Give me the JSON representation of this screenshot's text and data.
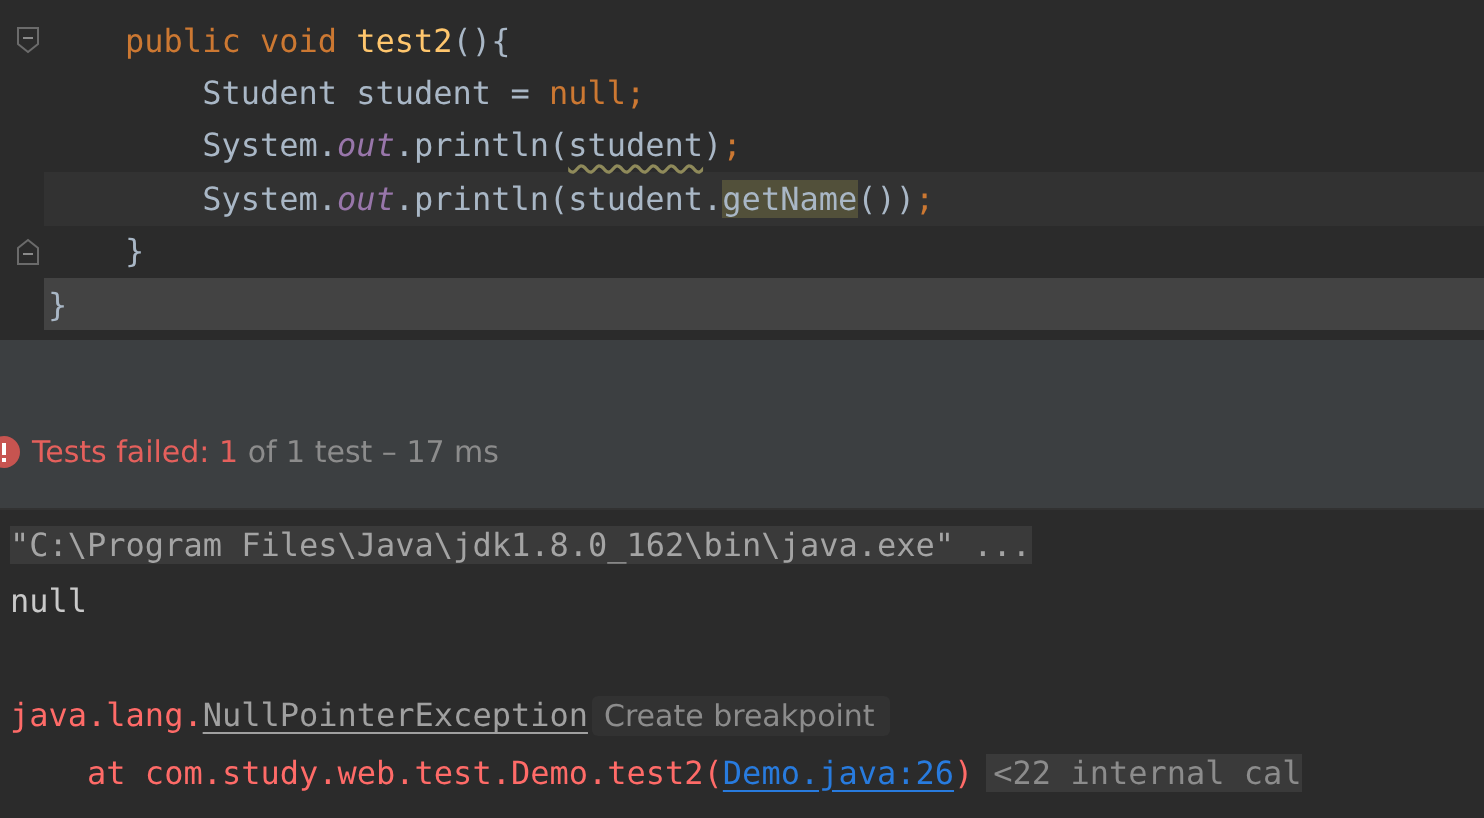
{
  "editor": {
    "lines": [
      {
        "kind": "fold-start",
        "current": false,
        "selected": false,
        "tokens": [
          {
            "text": "    public void ",
            "kind": "keyword"
          },
          {
            "text": "test2",
            "kind": "method"
          },
          {
            "text": "(){",
            "kind": "plain"
          }
        ]
      },
      {
        "kind": "code",
        "current": false,
        "selected": false,
        "tokens": [
          {
            "text": "        Student student = ",
            "kind": "plain"
          },
          {
            "text": "null",
            "kind": "keyword"
          },
          {
            "text": ";",
            "kind": "keyword"
          }
        ]
      },
      {
        "kind": "code",
        "current": false,
        "selected": false,
        "tokens": [
          {
            "text": "        System.",
            "kind": "plain"
          },
          {
            "text": "out",
            "kind": "field"
          },
          {
            "text": ".println(",
            "kind": "plain"
          },
          {
            "text": "student",
            "kind": "warning"
          },
          {
            "text": ")",
            "kind": "plain"
          },
          {
            "text": ";",
            "kind": "keyword"
          }
        ]
      },
      {
        "kind": "code",
        "current": true,
        "selected": false,
        "tokens": [
          {
            "text": "        System.",
            "kind": "plain"
          },
          {
            "text": "out",
            "kind": "field"
          },
          {
            "text": ".println(student.",
            "kind": "plain"
          },
          {
            "text": "getName",
            "kind": "highlight"
          },
          {
            "text": "())",
            "kind": "plain"
          },
          {
            "text": ";",
            "kind": "keyword"
          }
        ]
      },
      {
        "kind": "fold-end",
        "current": false,
        "selected": false,
        "tokens": [
          {
            "text": "    }",
            "kind": "plain"
          }
        ]
      },
      {
        "kind": "code",
        "current": false,
        "selected": true,
        "tokens": [
          {
            "text": "}",
            "kind": "plain"
          }
        ]
      }
    ]
  },
  "test_status": {
    "parts": [
      {
        "text": "Tests failed: 1",
        "kind": "error"
      },
      {
        "text": " of 1 test – 17 ms",
        "kind": "muted"
      }
    ]
  },
  "console": {
    "lines": [
      {
        "kind": "text",
        "tokens": [
          {
            "text": "\"C:\\Program Files\\Java\\jdk1.8.0_162\\bin\\java.exe\" ...",
            "kind": "command"
          }
        ]
      },
      {
        "kind": "text",
        "tokens": [
          {
            "text": "null",
            "kind": "plain"
          }
        ]
      },
      {
        "kind": "blank"
      },
      {
        "kind": "text",
        "tokens": [
          {
            "text": "java.lang.",
            "kind": "error"
          },
          {
            "text": "NullPointerException",
            "kind": "class-link"
          },
          {
            "text": "Create breakpoint",
            "kind": "chip"
          }
        ]
      },
      {
        "kind": "text",
        "tokens": [
          {
            "text": "    at com.study.web.test.Demo.test2(",
            "kind": "error"
          },
          {
            "text": "Demo.java:26",
            "kind": "link"
          },
          {
            "text": ")",
            "kind": "error"
          },
          {
            "text": "<22 internal cal",
            "kind": "folded"
          }
        ]
      }
    ]
  }
}
